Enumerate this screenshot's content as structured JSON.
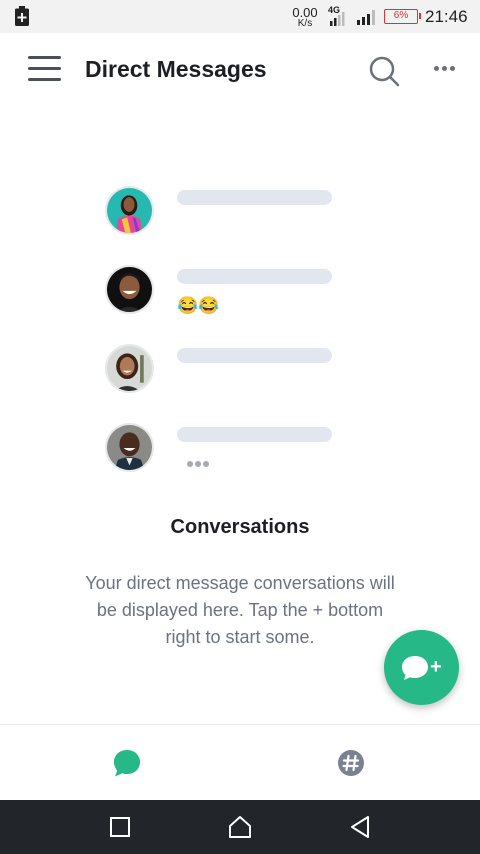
{
  "status_bar": {
    "net_speed_value": "0.00",
    "net_speed_unit": "K/s",
    "network_type": "4G",
    "battery_percent": "6%",
    "time": "21:46",
    "icons": [
      "battery-charging-icon",
      "signal-4g-icon",
      "signal-icon",
      "battery-icon"
    ]
  },
  "header": {
    "title": "Direct Messages",
    "icons": [
      "hamburger-menu-icon",
      "search-icon",
      "more-options-icon"
    ]
  },
  "illustration": {
    "conversations": [
      {
        "avatar": "avatar-woman-colorful-top",
        "extra": ""
      },
      {
        "avatar": "avatar-man-laughing",
        "extra": "😂😂"
      },
      {
        "avatar": "avatar-woman-smiling",
        "extra": ""
      },
      {
        "avatar": "avatar-man-smiling",
        "extra": "typing-dots"
      }
    ]
  },
  "empty_state": {
    "title": "Conversations",
    "description": "Your direct message conversations will be displayed here. Tap the + bottom right to start some."
  },
  "fab": {
    "icon": "new-chat-plus-icon",
    "label": "+"
  },
  "tabs": [
    {
      "name": "direct-messages",
      "icon": "chat-bubble-icon",
      "active": true,
      "color": "#26b887"
    },
    {
      "name": "channels",
      "icon": "hashtag-icon",
      "active": false,
      "color": "#7b8190"
    }
  ],
  "system_nav": {
    "icons": [
      "recent-apps-icon",
      "home-icon",
      "back-icon"
    ]
  },
  "colors": {
    "accent": "#26b887",
    "skeleton": "#e2e6ee",
    "nav_bar": "#22252a",
    "battery_low": "#e03030"
  }
}
